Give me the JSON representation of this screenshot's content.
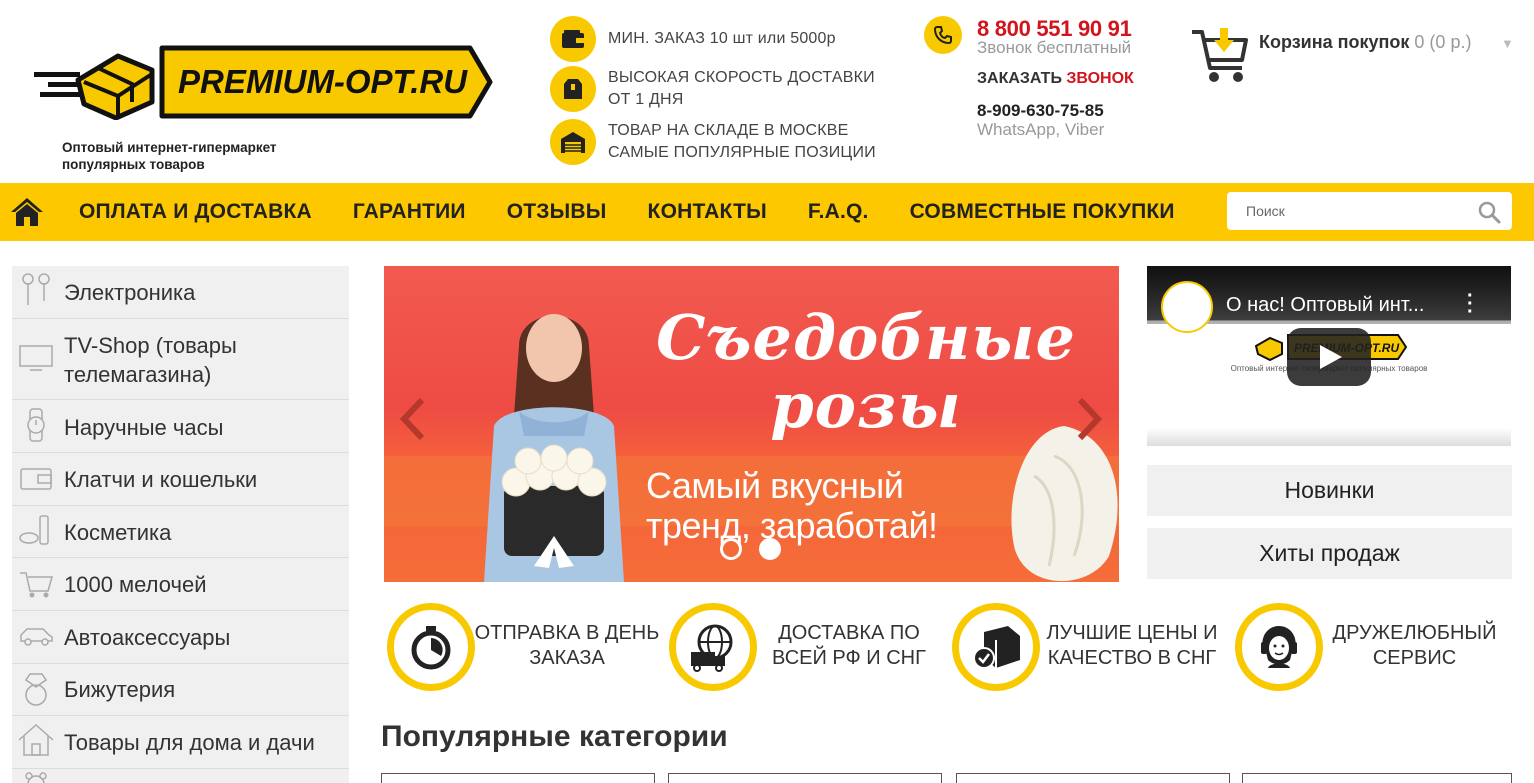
{
  "header": {
    "logo_text": "PREMIUM-OPT.RU",
    "tagline": "Оптовый интернет-гипермаркет популярных товаров",
    "features": [
      {
        "icon": "wallet-icon",
        "text": "МИН. ЗАКАЗ 10 шт или 5000р"
      },
      {
        "icon": "box-icon",
        "text": "ВЫСОКАЯ СКОРОСТЬ ДОСТАВКИ ОТ 1 ДНЯ"
      },
      {
        "icon": "warehouse-icon",
        "text": "ТОВАР НА СКЛАДЕ В МОСКВЕ САМЫЕ ПОПУЛЯРНЫЕ ПОЗИЦИИ"
      }
    ],
    "phone": "8 800 551 90 91",
    "phone_note": "Звонок бесплатный",
    "callback_prefix": "ЗАКАЗАТЬ",
    "callback_accent": "ЗВОНОК",
    "phone2": "8-909-630-75-85",
    "phone2_note": "WhatsApp, Viber",
    "cart": {
      "label": "Корзина покупок",
      "count": "0 (0 р.)"
    }
  },
  "nav": {
    "items": [
      "ОПЛАТА И ДОСТАВКА",
      "ГАРАНТИИ",
      "ОТЗЫВЫ",
      "КОНТАКТЫ",
      "F.A.Q.",
      "СОВМЕСТНЫЕ ПОКУПКИ"
    ],
    "search_placeholder": "Поиск"
  },
  "sidebar": {
    "categories": [
      {
        "label": "Электроника",
        "icon": "headphones-icon"
      },
      {
        "label": "TV-Shop (товары телемагазина)",
        "icon": "tv-icon"
      },
      {
        "label": "Наручные часы",
        "icon": "watch-icon"
      },
      {
        "label": "Клатчи и кошельки",
        "icon": "wallet-icon"
      },
      {
        "label": "Косметика",
        "icon": "cosmetics-icon"
      },
      {
        "label": "1000 мелочей",
        "icon": "basket-icon"
      },
      {
        "label": "Автоаксессуары",
        "icon": "car-icon"
      },
      {
        "label": "Бижутерия",
        "icon": "ring-icon"
      },
      {
        "label": "Товары для дома и дачи",
        "icon": "house-icon"
      }
    ]
  },
  "banner": {
    "title": "Съедобные розы",
    "subtitle": "Самый вкусный тренд, заработай!",
    "slides": 2,
    "active_slide": 1
  },
  "video": {
    "title": "О нас! Оптовый инт...",
    "caption": "Оптовый интернет-гипермаркет популярных товаров"
  },
  "side_buttons": [
    "Новинки",
    "Хиты продаж"
  ],
  "advantages": [
    {
      "icon": "stopwatch-icon",
      "text": "ОТПРАВКА В ДЕНЬ ЗАКАЗА"
    },
    {
      "icon": "globe-truck-icon",
      "text": "ДОСТАВКА ПО ВСЕЙ РФ И СНГ"
    },
    {
      "icon": "quality-box-icon",
      "text": "ЛУЧШИЕ ЦЕНЫ И КАЧЕСТВО В СНГ"
    },
    {
      "icon": "support-agent-icon",
      "text": "ДРУЖЕЛЮБНЫЙ СЕРВИС"
    }
  ],
  "popular_title": "Популярные категории",
  "colors": {
    "brand_yellow": "#fdc800",
    "accent_red": "#d3141c",
    "sidebar_bg": "#f0f0f0"
  }
}
